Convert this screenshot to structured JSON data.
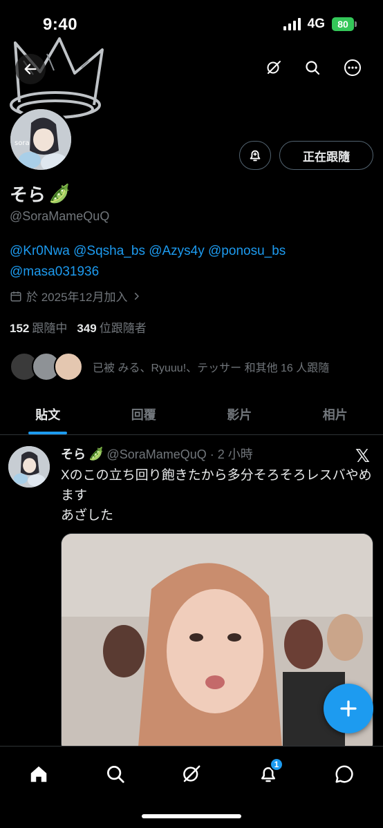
{
  "status_bar": {
    "time": "9:40",
    "network": "4G",
    "battery": "80"
  },
  "header": {
    "back_icon": "arrow-left-icon",
    "grok_icon": "grok-icon",
    "search_icon": "search-icon",
    "more_icon": "more-icon"
  },
  "profile": {
    "display_name": "そら",
    "display_name_emoji": "🫛",
    "handle": "@SoraMameQuQ",
    "bio_line1": "@Kr0Nwa @Sqsha_bs @Azys4y @ponosu_bs",
    "bio_line2": "@masa031936",
    "joined": "於 2025年12月加入",
    "following_count": "152",
    "following_label": "跟隨中",
    "followers_count": "349",
    "followers_label": "位跟隨者",
    "followed_by": "已被 みる、Ryuuu!、テッサー 和其他 16 人跟隨",
    "follow_button": "正在跟隨",
    "avatar_label": "sora"
  },
  "tabs": [
    "貼文",
    "回覆",
    "影片",
    "相片"
  ],
  "post": {
    "name": "そら",
    "emoji": "🫛",
    "meta": "@SoraMameQuQ · 2 小時",
    "text": "Xのこの立ち回り飽きたから多分そろそろレスバやめます\nあざした"
  },
  "notifications_badge": "1",
  "colors": {
    "accent": "#1d9bf0",
    "background": "#000000",
    "secondary_text": "#71767b",
    "battery": "#34c759"
  }
}
